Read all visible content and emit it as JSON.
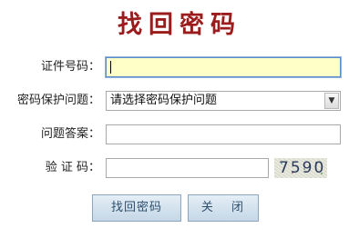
{
  "page": {
    "title": "找回密码"
  },
  "form": {
    "id_number": {
      "label": "证件号码：",
      "value": ""
    },
    "security_question": {
      "label": "密码保护问题：",
      "selected": "请选择密码保护问题"
    },
    "answer": {
      "label": "问题答案：",
      "value": ""
    },
    "captcha": {
      "label": "验 证 码：",
      "value": "",
      "code": "7590"
    }
  },
  "buttons": {
    "find_password": "找回密码",
    "close": "关 闭"
  },
  "colors": {
    "title": "#9b1c1c",
    "focused_field_bg": "#ffffc8",
    "button_text": "#2d4f6e"
  },
  "icons": {
    "select_arrow": "chevron-down-icon"
  }
}
